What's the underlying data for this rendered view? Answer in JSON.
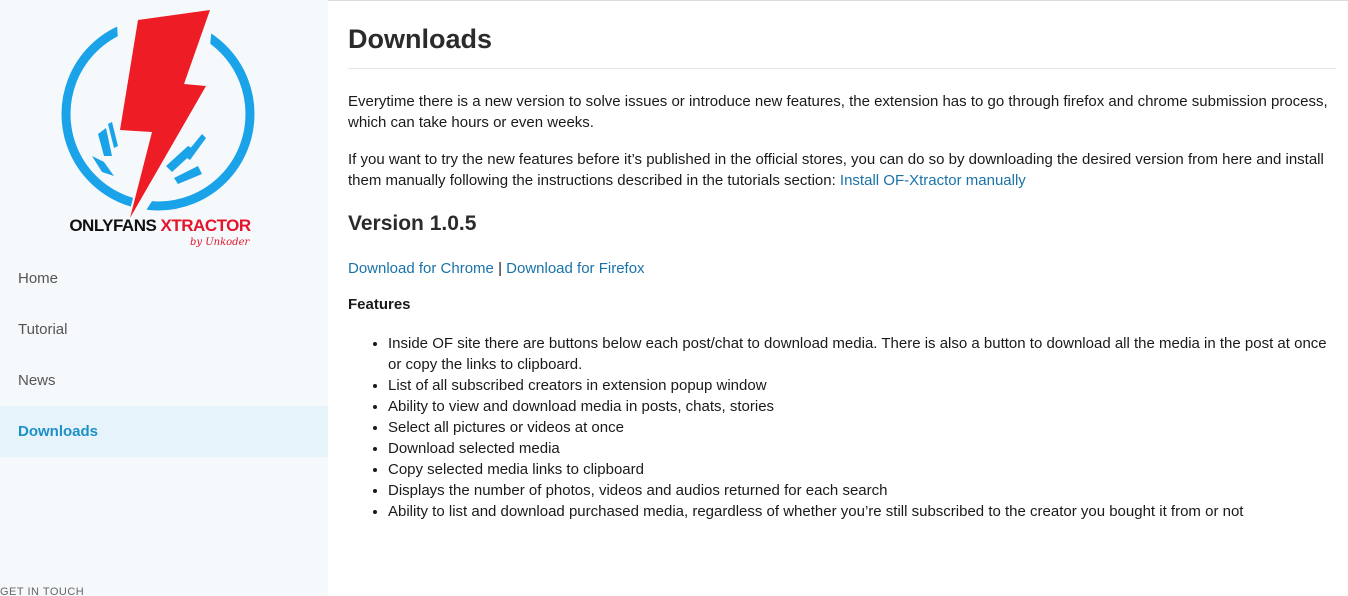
{
  "sidebar": {
    "logo": {
      "brand_part1": "ONLYFANS ",
      "brand_part2": "XTRACTOR",
      "byline": "by Unkoder",
      "accent_blue": "#1aa3e8",
      "accent_red": "#ee1c25"
    },
    "nav": [
      {
        "label": "Home"
      },
      {
        "label": "Tutorial"
      },
      {
        "label": "News"
      },
      {
        "label": "Downloads",
        "active": true
      }
    ],
    "footer_label": "GET IN TOUCH"
  },
  "main": {
    "title": "Downloads",
    "intro1": "Everytime there is a new version to solve issues or introduce new features, the extension has to go through firefox and chrome submission process, which can take hours or even weeks.",
    "intro2_text": "If you want to try the new features before it’s published in the official stores, you can do so by downloading the desired version from here and install them manually following the instructions described in the tutorials section: ",
    "intro2_link": "Install OF-Xtractor manually",
    "version_title": "Version 1.0.5",
    "download_chrome": "Download for Chrome",
    "separator": "|",
    "download_firefox": "Download for Firefox",
    "features_title": "Features",
    "features": [
      "Inside OF site there are buttons below each post/chat to download media. There is also a button to download all the media in the post at once or copy the links to clipboard.",
      "List of all subscribed creators in extension popup window",
      "Ability to view and download media in posts, chats, stories",
      "Select all pictures or videos at once",
      "Download selected media",
      "Copy selected media links to clipboard",
      "Displays the number of photos, videos and audios returned for each search",
      "Ability to list and download purchased media, regardless of whether you’re still subscribed to the creator you bought it from or not"
    ],
    "link_color": "#1a73a8"
  }
}
